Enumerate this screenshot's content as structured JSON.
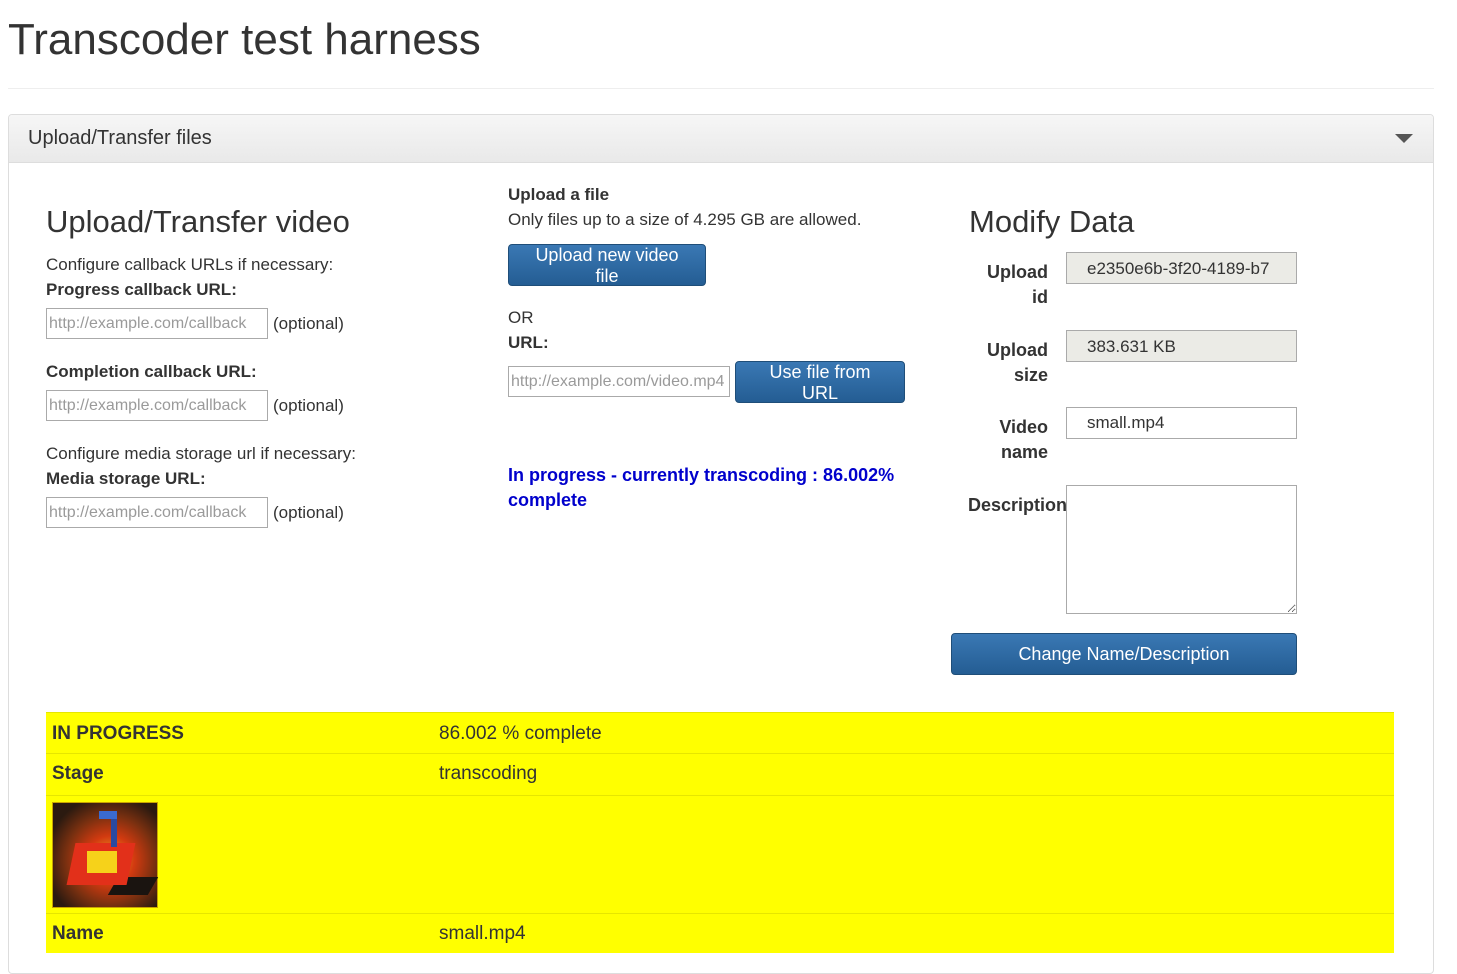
{
  "page": {
    "title": "Transcoder test harness"
  },
  "panel": {
    "heading": "Upload/Transfer files"
  },
  "upload_transfer": {
    "heading": "Upload/Transfer video",
    "configure_callback_text": "Configure callback URLs if necessary:",
    "progress_label": "Progress callback URL:",
    "progress_placeholder": "http://example.com/callback",
    "completion_label": "Completion callback URL:",
    "completion_placeholder": "http://example.com/callback",
    "configure_storage_text": "Configure media storage url if necessary:",
    "storage_label": "Media storage URL:",
    "storage_placeholder": "http://example.com/callback",
    "optional_text": "(optional)"
  },
  "upload_file": {
    "heading": "Upload a file",
    "size_note": "Only files up to a size of 4.295 GB are allowed.",
    "upload_button": "Upload new video file",
    "or_text": "OR",
    "url_label": "URL:",
    "url_placeholder": "http://example.com/video.mp4",
    "use_url_button": "Use file from URL",
    "status_text": "In progress - currently transcoding : 86.002% complete"
  },
  "modify": {
    "heading": "Modify Data",
    "upload_id_label_1": "Upload",
    "upload_id_label_2": "id",
    "upload_id_value": "e2350e6b-3f20-4189-b7",
    "upload_size_label_1": "Upload",
    "upload_size_label_2": "size",
    "upload_size_value": "383.631 KB",
    "video_name_label_1": "Video",
    "video_name_label_2": "name",
    "video_name_value": "small.mp4",
    "description_label": "Description",
    "description_value": "",
    "change_button": "Change Name/Description"
  },
  "status_table": {
    "status_label": "IN PROGRESS",
    "status_value": "86.002 % complete",
    "stage_label": "Stage",
    "stage_value": "transcoding",
    "name_label": "Name",
    "name_value": "small.mp4"
  },
  "colors": {
    "status_blue": "#0000cc",
    "highlight_yellow": "#ffff00",
    "button_blue": "#2d6aa3"
  }
}
